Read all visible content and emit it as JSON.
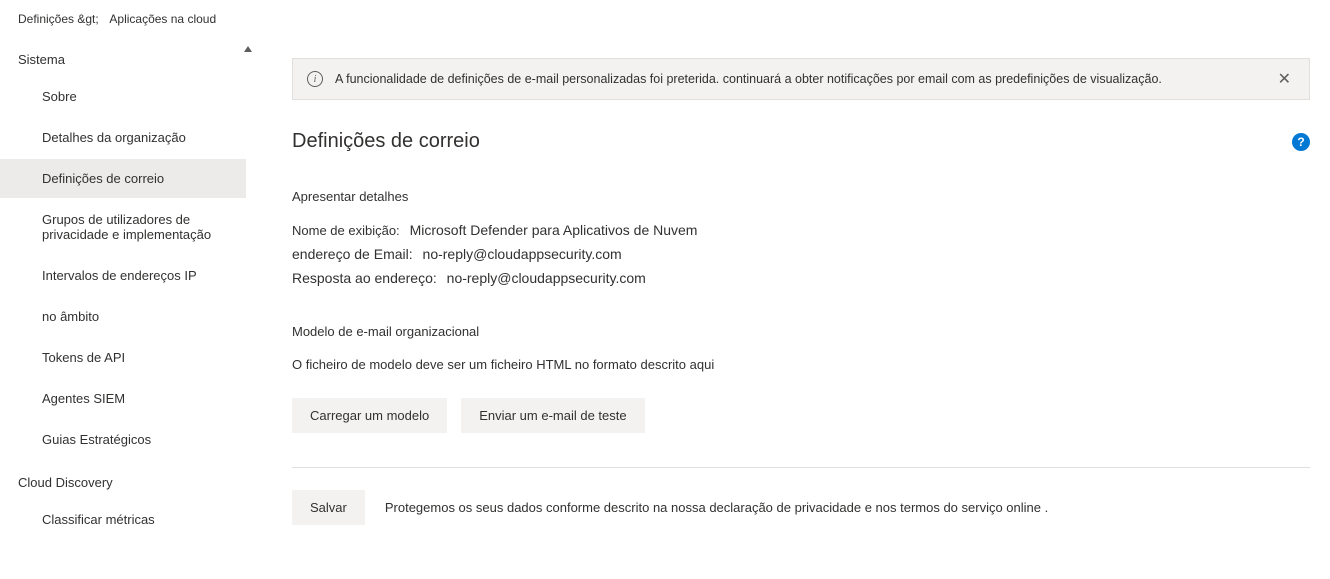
{
  "breadcrumb": {
    "part1": "Definições &gt;",
    "part2": "Aplicações na cloud"
  },
  "sidebar": {
    "section1_title": "Sistema",
    "items1": [
      {
        "label": "Sobre"
      },
      {
        "label": "Detalhes da organização"
      },
      {
        "label": "Definições de correio",
        "active": true
      },
      {
        "label": "Grupos de utilizadores de privacidade e implementação"
      },
      {
        "label": "Intervalos de endereços IP"
      },
      {
        "label": "no âmbito"
      },
      {
        "label": "Tokens de API"
      },
      {
        "label": "Agentes SIEM"
      },
      {
        "label": "Guias Estratégicos"
      }
    ],
    "section2_title": "Cloud Discovery",
    "items2": [
      {
        "label": "Classificar métricas"
      }
    ]
  },
  "banner": {
    "text": "A funcionalidade de definições de e-mail personalizadas foi preterida. continuará a obter notificações por email com as predefinições de visualização."
  },
  "page": {
    "title": "Definições de correio"
  },
  "details": {
    "section_label": "Apresentar detalhes",
    "display_name_label": "Nome de exibição:",
    "display_name_value": "Microsoft Defender para Aplicativos de Nuvem",
    "email_label": "endereço de Email:",
    "email_value": "no-reply@cloudappsecurity.com",
    "reply_label": "Resposta ao endereço:",
    "reply_value": "no-reply@cloudappsecurity.com"
  },
  "template": {
    "section_label": "Modelo de e-mail organizacional",
    "hint": "O ficheiro de modelo deve ser um ficheiro HTML no formato descrito aqui",
    "upload_btn": "Carregar um modelo",
    "test_btn": "Enviar um e-mail de teste"
  },
  "footer": {
    "save_btn": "Salvar",
    "privacy_text": "Protegemos os seus dados conforme descrito na nossa declaração de privacidade e nos termos do serviço online ."
  }
}
